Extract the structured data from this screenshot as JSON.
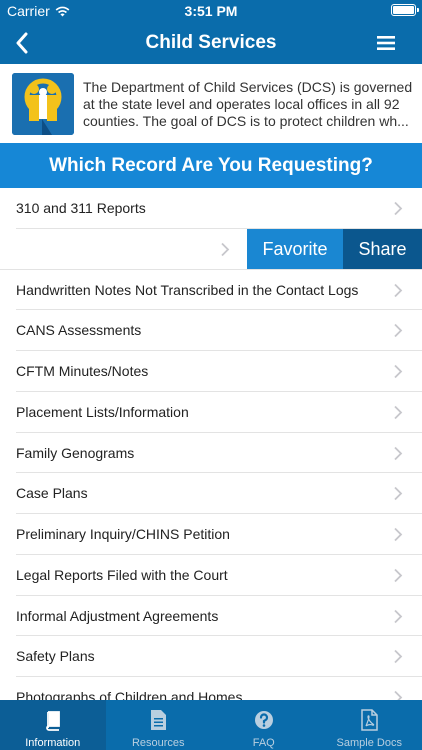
{
  "status": {
    "carrier": "Carrier",
    "time": "3:51 PM"
  },
  "nav": {
    "title": "Child Services"
  },
  "intro": {
    "text": "The Department of Child Services (DCS) is governed at the state level and operates local offices in all 92 counties. The goal of DCS is to protect children wh..."
  },
  "section": {
    "heading": "Which Record Are You Requesting?"
  },
  "records": [
    {
      "label": "310 and 311 Reports"
    },
    {
      "label": ""
    },
    {
      "label": "Handwritten Notes Not Transcribed in the Contact Logs"
    },
    {
      "label": "CANS Assessments"
    },
    {
      "label": "CFTM Minutes/Notes"
    },
    {
      "label": "Placement Lists/Information"
    },
    {
      "label": "Family Genograms"
    },
    {
      "label": "Case Plans"
    },
    {
      "label": "Preliminary Inquiry/CHINS Petition"
    },
    {
      "label": "Legal Reports Filed with the Court"
    },
    {
      "label": "Informal Adjustment Agreements"
    },
    {
      "label": "Safety Plans"
    },
    {
      "label": "Photographs of Children and Homes"
    }
  ],
  "swipe_actions": {
    "favorite": "Favorite",
    "share": "Share"
  },
  "tabs": [
    {
      "label": "Information",
      "icon": "book-icon",
      "active": true
    },
    {
      "label": "Resources",
      "icon": "document-icon",
      "active": false
    },
    {
      "label": "FAQ",
      "icon": "question-icon",
      "active": false
    },
    {
      "label": "Sample Docs",
      "icon": "pdf-icon",
      "active": false
    }
  ],
  "colors": {
    "header": "#0a6cab",
    "section": "#1687d6",
    "favorite": "#1a87d2",
    "share": "#0b578e"
  }
}
